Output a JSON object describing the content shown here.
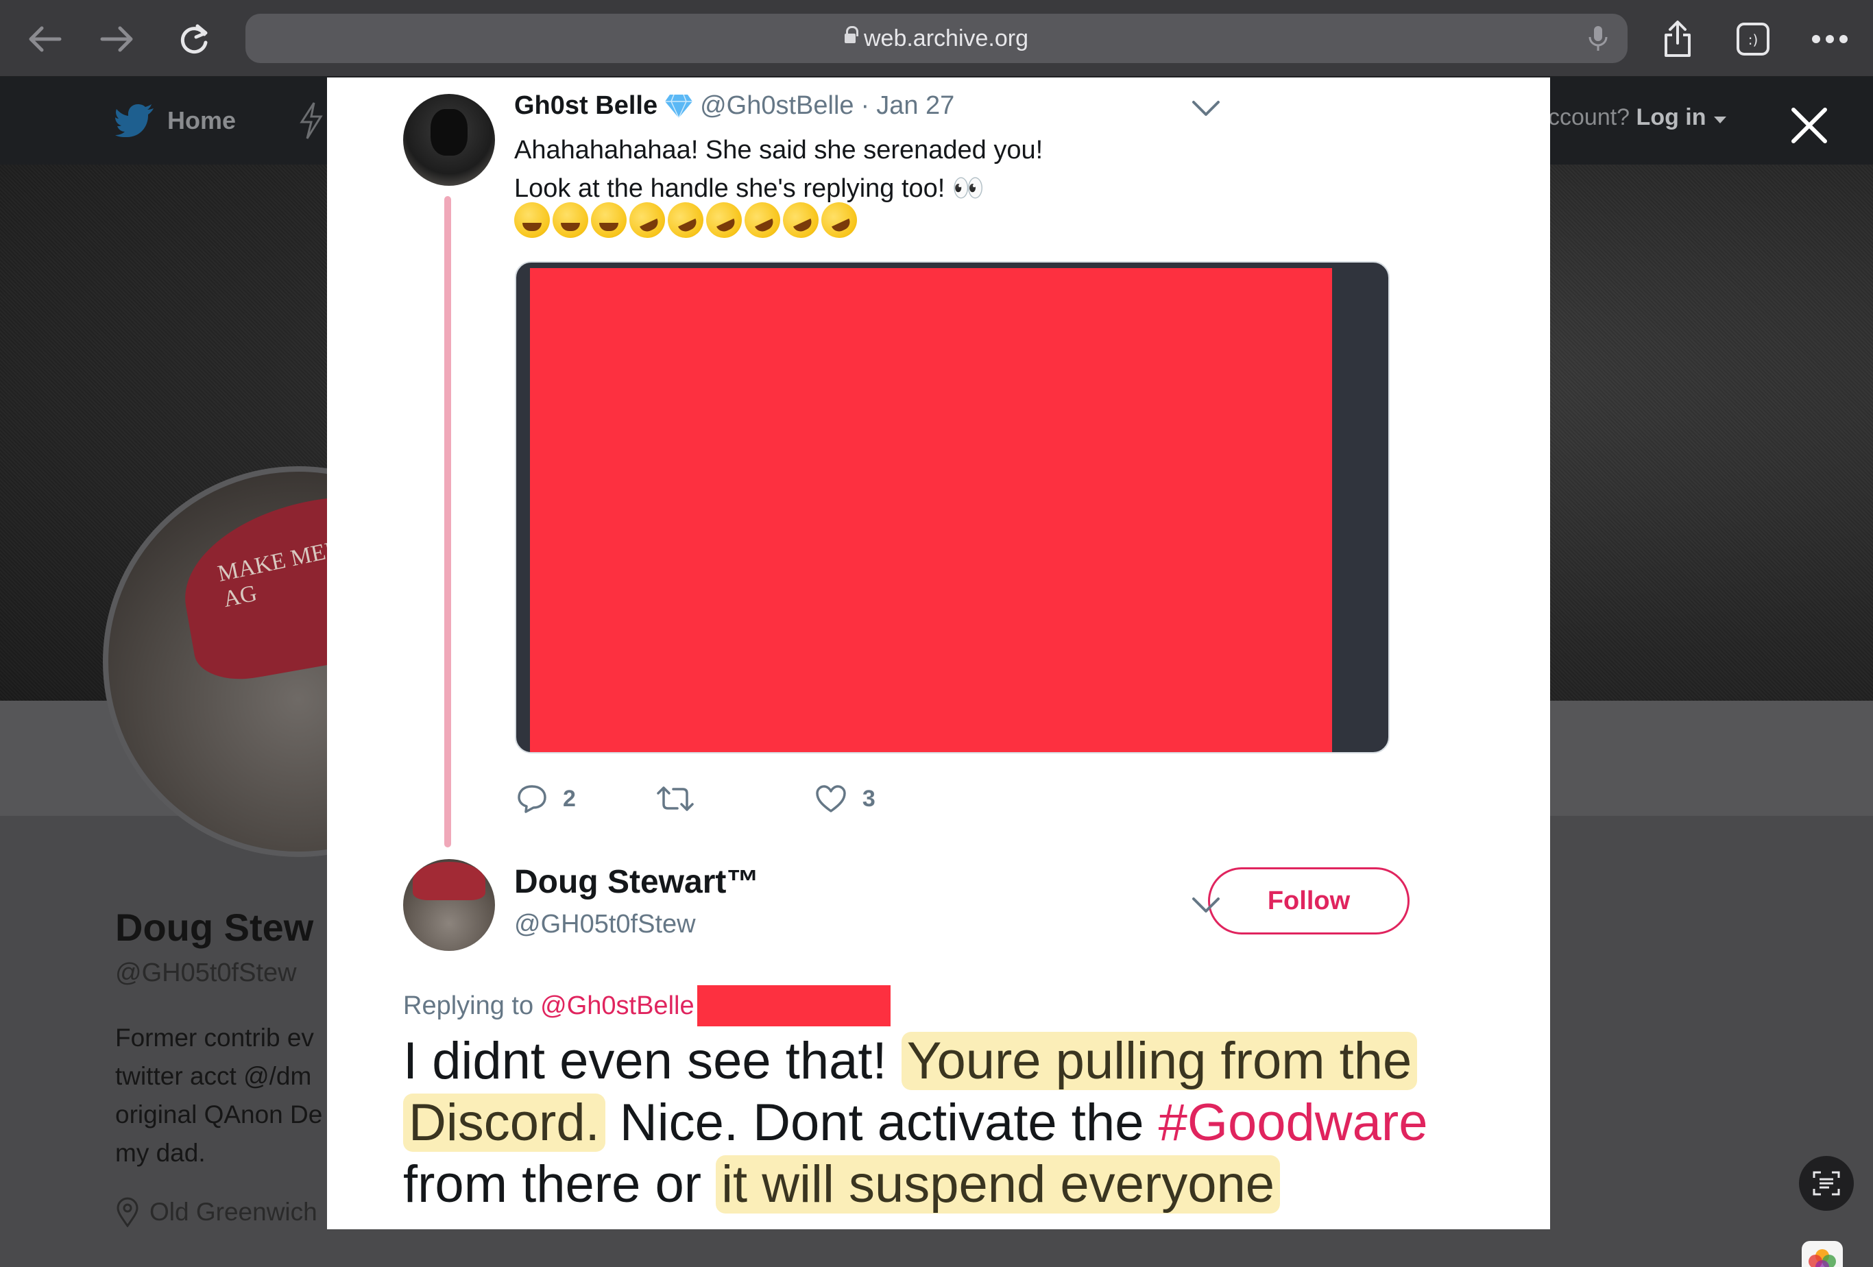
{
  "browser": {
    "url": "web.archive.org"
  },
  "background_page": {
    "nav_home": "Home",
    "nav_account_prefix": "ccount?",
    "nav_login": "Log in",
    "profile_name": "Doug Stew",
    "profile_handle": "@GH05t0fStew",
    "bio_lines": [
      "Former contrib ev",
      "twitter acct @/dm",
      "original QAnon De",
      "my dad."
    ],
    "location": "Old Greenwich",
    "hat_text": "MAKE MENS BRITISH AG"
  },
  "tweet1": {
    "name": "Gh0st Belle",
    "handle": "@Gh0stBelle",
    "date": "Jan 27",
    "line1": "Ahahahahahaa! She said she serenaded you!",
    "line2": "Look at the handle she's replying too! 👀",
    "reply_count": "2",
    "like_count": "3"
  },
  "tweet2": {
    "name": "Doug Stewart™",
    "handle": "@GH05t0fStew",
    "follow_label": "Follow",
    "replying_prefix": "Replying to",
    "replying_mention": "@Gh0stBelle",
    "text_a": "I didnt even see that!",
    "text_b": "Youre pulling from the",
    "text_c": "Discord.",
    "text_d": "Nice. Dont activate the",
    "text_hashtag": "#Goodware",
    "text_e": "from there or",
    "text_f": "it will suspend everyone"
  },
  "colors": {
    "accent": "#e0245e",
    "redaction": "#fd3040",
    "highlight": "#fae8a0",
    "twitter_blue": "#1da1f2"
  }
}
